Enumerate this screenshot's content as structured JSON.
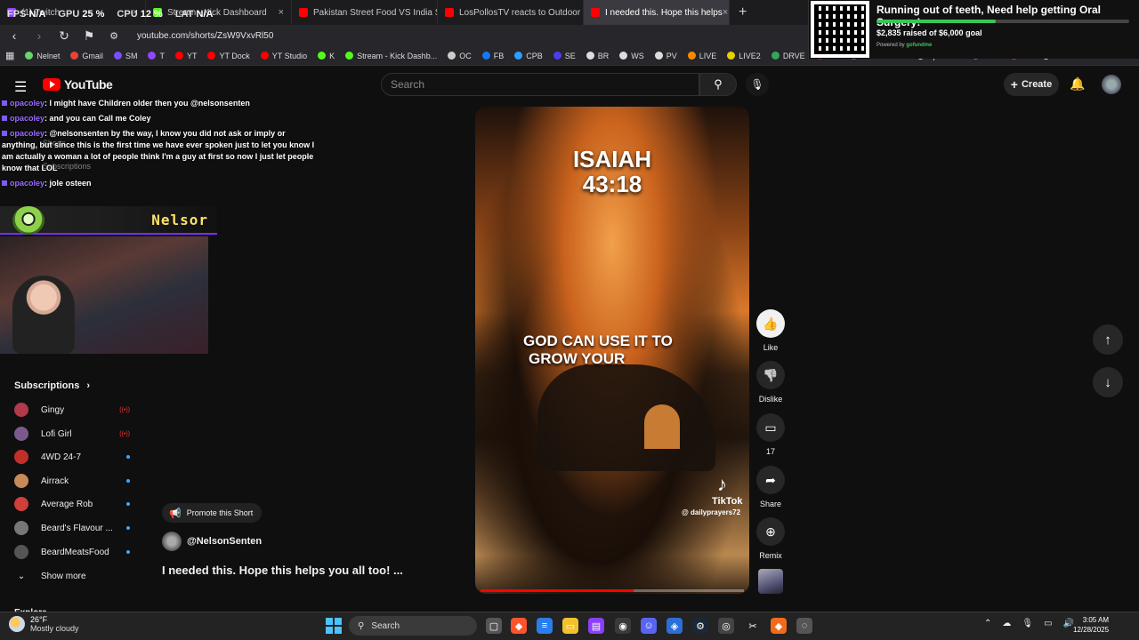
{
  "overlay_stats": {
    "fps_label": "FPS",
    "fps_value": "N/A",
    "gpu_label": "GPU",
    "gpu_value": "25",
    "cpu_label": "CPU",
    "cpu_value": "12",
    "lat_label": "LAT",
    "lat_value": "N/A"
  },
  "tabs": [
    {
      "title": "(1) Twitch",
      "color": "#9146ff"
    },
    {
      "title": "Stream - Kick Dashboard",
      "color": "#53fc18"
    },
    {
      "title": "Pakistan Street Food VS India Street Fo",
      "color": "#ff0000"
    },
    {
      "title": "LosPollosTV reacts to Outdoor Boys",
      "color": "#ff0000"
    },
    {
      "title": "I needed this. Hope this helps",
      "color": "#ff0000",
      "active": true
    }
  ],
  "new_tab_icon": "+",
  "address": {
    "url": "youtube.com/shorts/ZsW9VxvRl50"
  },
  "bookmarks": [
    {
      "label": "Nelnet",
      "color": "#6bd46b"
    },
    {
      "label": "Gmail",
      "color": "#ea4335"
    },
    {
      "label": "SM",
      "color": "#7b4dff"
    },
    {
      "label": "T",
      "color": "#9146ff"
    },
    {
      "label": "YT",
      "color": "#ff0000"
    },
    {
      "label": "YT Dock",
      "color": "#ff0000"
    },
    {
      "label": "YT Studio",
      "color": "#ff0000"
    },
    {
      "label": "K",
      "color": "#53fc18"
    },
    {
      "label": "Stream - Kick Dashb...",
      "color": "#53fc18"
    },
    {
      "label": "OC",
      "color": "#ccc"
    },
    {
      "label": "FB",
      "color": "#1877f2"
    },
    {
      "label": "CPB",
      "color": "#2aa0ff"
    },
    {
      "label": "SE",
      "color": "#4b3df0"
    },
    {
      "label": "BR",
      "color": "#ddd"
    },
    {
      "label": "WS",
      "color": "#ddd"
    },
    {
      "label": "PV",
      "color": "#ddd"
    },
    {
      "label": "LIVE",
      "color": "#ff8a00"
    },
    {
      "label": "LIVE2",
      "color": "#e6d200"
    },
    {
      "label": "DRVE",
      "color": "#34a853"
    },
    {
      "label": "SO",
      "color": "#ff0000"
    },
    {
      "label": "edule Twitch",
      "color": "#9146ff"
    },
    {
      "label": "Epidemic",
      "color": "#ddd"
    },
    {
      "label": "UPP",
      "color": "#c447c4"
    },
    {
      "label": "AL",
      "color": "#e91e63"
    },
    {
      "label": "Thematic",
      "color": "#ddd"
    }
  ],
  "fundraiser": {
    "title": "Running out of teeth, Need help getting Oral Surgery!",
    "amount": "$2,835 raised of $6,000 goal",
    "powered": "Powered by",
    "brand": "gofundme",
    "progress_fraction": 0.4725
  },
  "youtube": {
    "logo": "YouTube",
    "search_placeholder": "Search",
    "create_label": "Create"
  },
  "chat": [
    {
      "user": "opacoley",
      "text": ": I might have Children older then you @nelsonsenten"
    },
    {
      "user": "opacoley",
      "text": ": and you can Call me Coley"
    },
    {
      "user": "opacoley",
      "text": ": @nelsonsenten by the way, I know you did not ask or imply or anything, but since this is the first time we have ever spoken just to let you know I am actually a woman a lot of people think I'm a guy at first so now I just let people know that LOL"
    },
    {
      "user": "opacoley",
      "text": ": jole osteen"
    }
  ],
  "sidebar_ghost": {
    "shorts": "Shorts",
    "subscriptions": "Subscriptions"
  },
  "cam": {
    "name": "Nelsor"
  },
  "sidebar": {
    "subscriptions_title": "Subscriptions",
    "channels": [
      {
        "name": "Gingy",
        "status": "live",
        "avatar_color": "#b23a4a"
      },
      {
        "name": "Lofi Girl",
        "status": "live",
        "avatar_color": "#7a5a8c"
      },
      {
        "name": "4WD 24-7",
        "status": "dot",
        "avatar_color": "#c0302a"
      },
      {
        "name": "Airrack",
        "status": "dot",
        "avatar_color": "#c98a5a"
      },
      {
        "name": "Average Rob",
        "status": "dot",
        "avatar_color": "#d0403a"
      },
      {
        "name": "Beard's Flavour ...",
        "status": "dot",
        "avatar_color": "#777"
      },
      {
        "name": "BeardMeatsFood",
        "status": "dot",
        "avatar_color": "#555"
      }
    ],
    "live_label": "((•))",
    "show_more": "Show more",
    "explore": "Explore"
  },
  "short": {
    "ref_line1": "ISAIAH",
    "ref_line2": "43:18",
    "quote_line1": "GOD CAN USE IT TO",
    "quote_line2": "GROW YOUR",
    "tiktok": "TikTok",
    "tiktok_handle": "@ dailyprayers72",
    "progress_fraction": 0.58
  },
  "actions": {
    "like": "Like",
    "dislike": "Dislike",
    "comments": "17",
    "share": "Share",
    "remix": "Remix"
  },
  "info": {
    "promote": "Promote this Short",
    "channel": "@NelsonSenten",
    "title": "I needed this. Hope this helps you all too! ..."
  },
  "taskbar": {
    "temp": "26°F",
    "condition": "Mostly cloudy",
    "search": "Search",
    "time": "3:05 AM",
    "date": "12/28/2025"
  }
}
